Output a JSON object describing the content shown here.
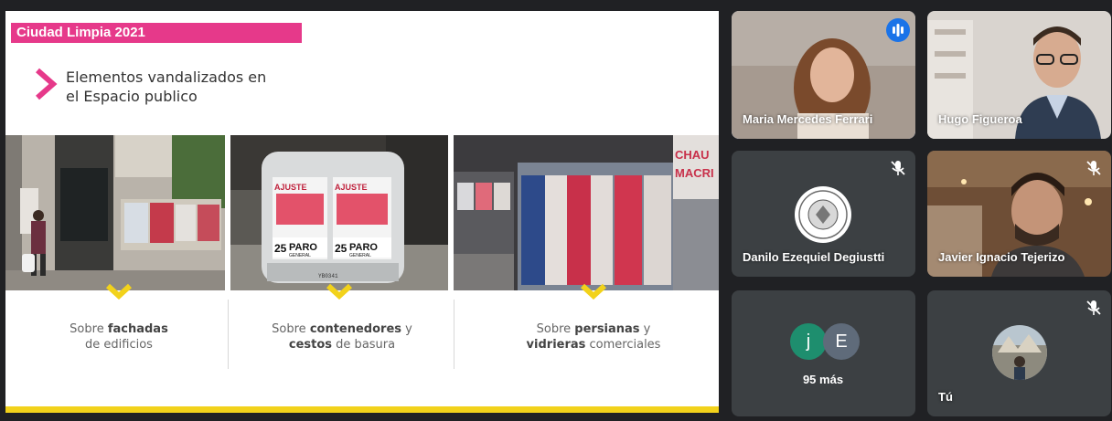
{
  "slide": {
    "tag": "Ciudad Limpia 2021",
    "heading_line1": "Elementos vandalizados en",
    "heading_line2": "el Espacio publico",
    "captions": [
      {
        "pre": "Sobre ",
        "bold": "fachadas",
        "post": "",
        "line2_bold": "",
        "line2": "de edificios"
      },
      {
        "pre": "Sobre ",
        "bold": "contenedores",
        "post": " y",
        "line2_bold": "cestos",
        "line2": " de basura"
      },
      {
        "pre": "Sobre ",
        "bold": "persianas",
        "post": " y",
        "line2_bold": "vidrieras",
        "line2": " comerciales"
      }
    ],
    "poster_text": {
      "paro": "PARO",
      "general": "GENERAL",
      "num": "25",
      "ajuste": "AJUSTE",
      "chau": "CHAU",
      "macri": "MACRI",
      "plate": "YB0341"
    },
    "colors": {
      "accent_pink": "#e6398a",
      "accent_yellow": "#f2d21b"
    }
  },
  "participants": [
    {
      "name": "Maria Mercedes Ferrari",
      "state": "speaking",
      "icon": "speaking-icon"
    },
    {
      "name": "Hugo Figueroa",
      "state": "video",
      "icon": ""
    },
    {
      "name": "Danilo Ezequiel Degiustti",
      "state": "muted",
      "icon": "mic-off-icon"
    },
    {
      "name": "Javier Ignacio Tejerizo",
      "state": "muted",
      "icon": "mic-off-icon"
    },
    {
      "initials": [
        "j",
        "E"
      ],
      "more_label": "95 más",
      "state": "overflow"
    },
    {
      "name": "Tú",
      "state": "muted",
      "icon": "mic-off-icon"
    }
  ]
}
